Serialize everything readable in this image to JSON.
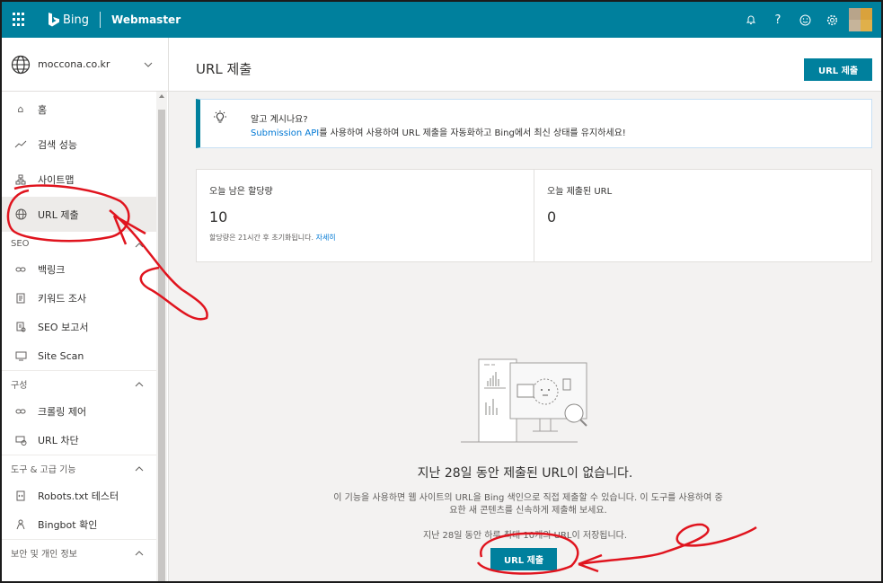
{
  "topbar": {
    "brand": "Bing",
    "product": "Webmaster",
    "icons": [
      "waffle-icon",
      "bell-icon",
      "help-icon",
      "smiley-icon",
      "gear-icon"
    ]
  },
  "site_selector": {
    "site": "moccona.co.kr"
  },
  "nav": {
    "home": "홈",
    "search_performance": "검색 성능",
    "sitemaps": "사이트맵",
    "url_submission": "URL 제출",
    "seo_section": "SEO",
    "backlinks": "백링크",
    "keyword_research": "키워드 조사",
    "seo_reports": "SEO 보고서",
    "site_scan": "Site Scan",
    "config_section": "구성",
    "crawl_control": "크롤링 제어",
    "block_urls": "URL 차단",
    "tools_section": "도구 & 고급 기능",
    "robots_tester": "Robots.txt 테스터",
    "bingbot_verify": "Bingbot 확인",
    "security_section": "보안 및 개인 정보"
  },
  "page": {
    "title": "URL 제출",
    "submit_button": "URL 제출"
  },
  "banner": {
    "title": "알고 계시나요?",
    "link": "Submission API",
    "text": "를 사용하여 사용하여 URL 제출을 자동화하고 Bing에서 최신 상태를 유지하세요!"
  },
  "stats": {
    "quota_label": "오늘 남은 할당량",
    "quota_value": "10",
    "quota_note": "할당량은 21시간 후 초기화됩니다.",
    "quota_link": "자세히",
    "submitted_label": "오늘 제출된 URL",
    "submitted_value": "0"
  },
  "empty": {
    "title": "지난 28일 동안 제출된 URL이 없습니다.",
    "desc": "이 기능을 사용하면 웹 사이트의 URL을 Bing 색인으로 직접 제출할 수 있습니다. 이 도구를 사용하여 중요한 새 콘텐츠를 신속하게 제출해 보세요.",
    "note": "지난 28일 동안 하루 최대 10개의 URL이 저장됩니다.",
    "button": "URL 제출"
  },
  "colors": {
    "brand": "#00809d",
    "link": "#0078d4",
    "annotation": "#e0141e"
  }
}
